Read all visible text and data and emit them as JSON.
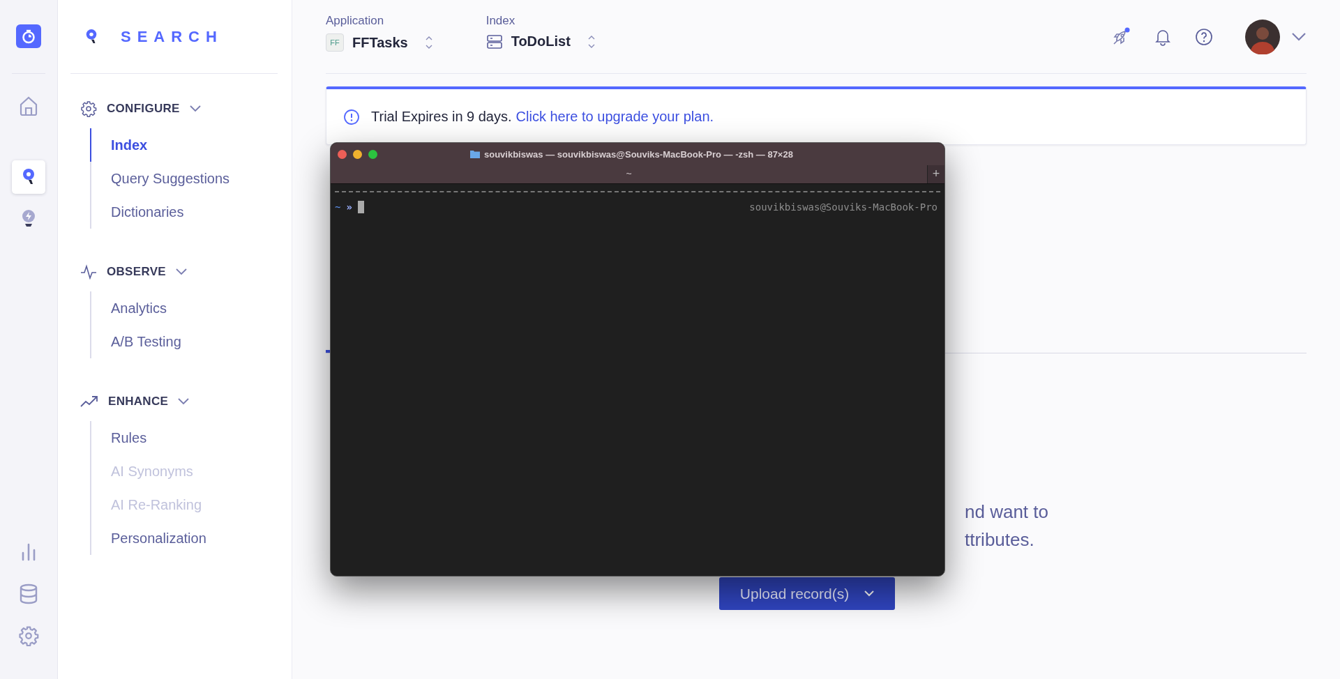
{
  "rail": {
    "top": [
      {
        "kind": "home",
        "selected": false
      },
      {
        "kind": "search",
        "selected": true
      },
      {
        "kind": "bulb",
        "selected": false
      }
    ],
    "bottom": [
      {
        "kind": "chart",
        "selected": false
      },
      {
        "kind": "database",
        "selected": false
      },
      {
        "kind": "gear",
        "selected": false
      }
    ]
  },
  "brand": {
    "name": "SEARCH"
  },
  "nav": [
    {
      "kind": "gear",
      "title": "CONFIGURE",
      "expanded": true,
      "items": [
        {
          "label": "Index",
          "selected": true,
          "disabled": false
        },
        {
          "label": "Query Suggestions",
          "selected": false,
          "disabled": false
        },
        {
          "label": "Dictionaries",
          "selected": false,
          "disabled": false
        }
      ]
    },
    {
      "kind": "pulse",
      "title": "OBSERVE",
      "expanded": true,
      "items": [
        {
          "label": "Analytics",
          "selected": false,
          "disabled": false
        },
        {
          "label": "A/B Testing",
          "selected": false,
          "disabled": false
        }
      ]
    },
    {
      "kind": "trend",
      "title": "ENHANCE",
      "expanded": true,
      "items": [
        {
          "label": "Rules",
          "selected": false,
          "disabled": false
        },
        {
          "label": "AI Synonyms",
          "selected": false,
          "disabled": true
        },
        {
          "label": "AI Re-Ranking",
          "selected": false,
          "disabled": true
        },
        {
          "label": "Personalization",
          "selected": false,
          "disabled": false
        }
      ]
    }
  ],
  "header": {
    "application": {
      "label": "Application",
      "badge": "FF",
      "value": "FFTasks"
    },
    "index": {
      "label": "Index",
      "value": "ToDoList"
    },
    "rocket_unread": true
  },
  "banner": {
    "text": "Trial Expires in 9 days.",
    "link": "Click here to upgrade your plan."
  },
  "empty_state": {
    "lines": [
      "nd want to",
      "ttributes."
    ],
    "button": "Upload record(s)"
  },
  "terminal": {
    "title": "souvikbiswas — souvikbiswas@Souviks-MacBook-Pro — -zsh — 87×28",
    "tab": "~",
    "new_tab": "+",
    "prompt_dir": "~",
    "prompt_symbol": "»",
    "right_prompt": "souvikbiswas@Souviks-MacBook-Pro"
  }
}
